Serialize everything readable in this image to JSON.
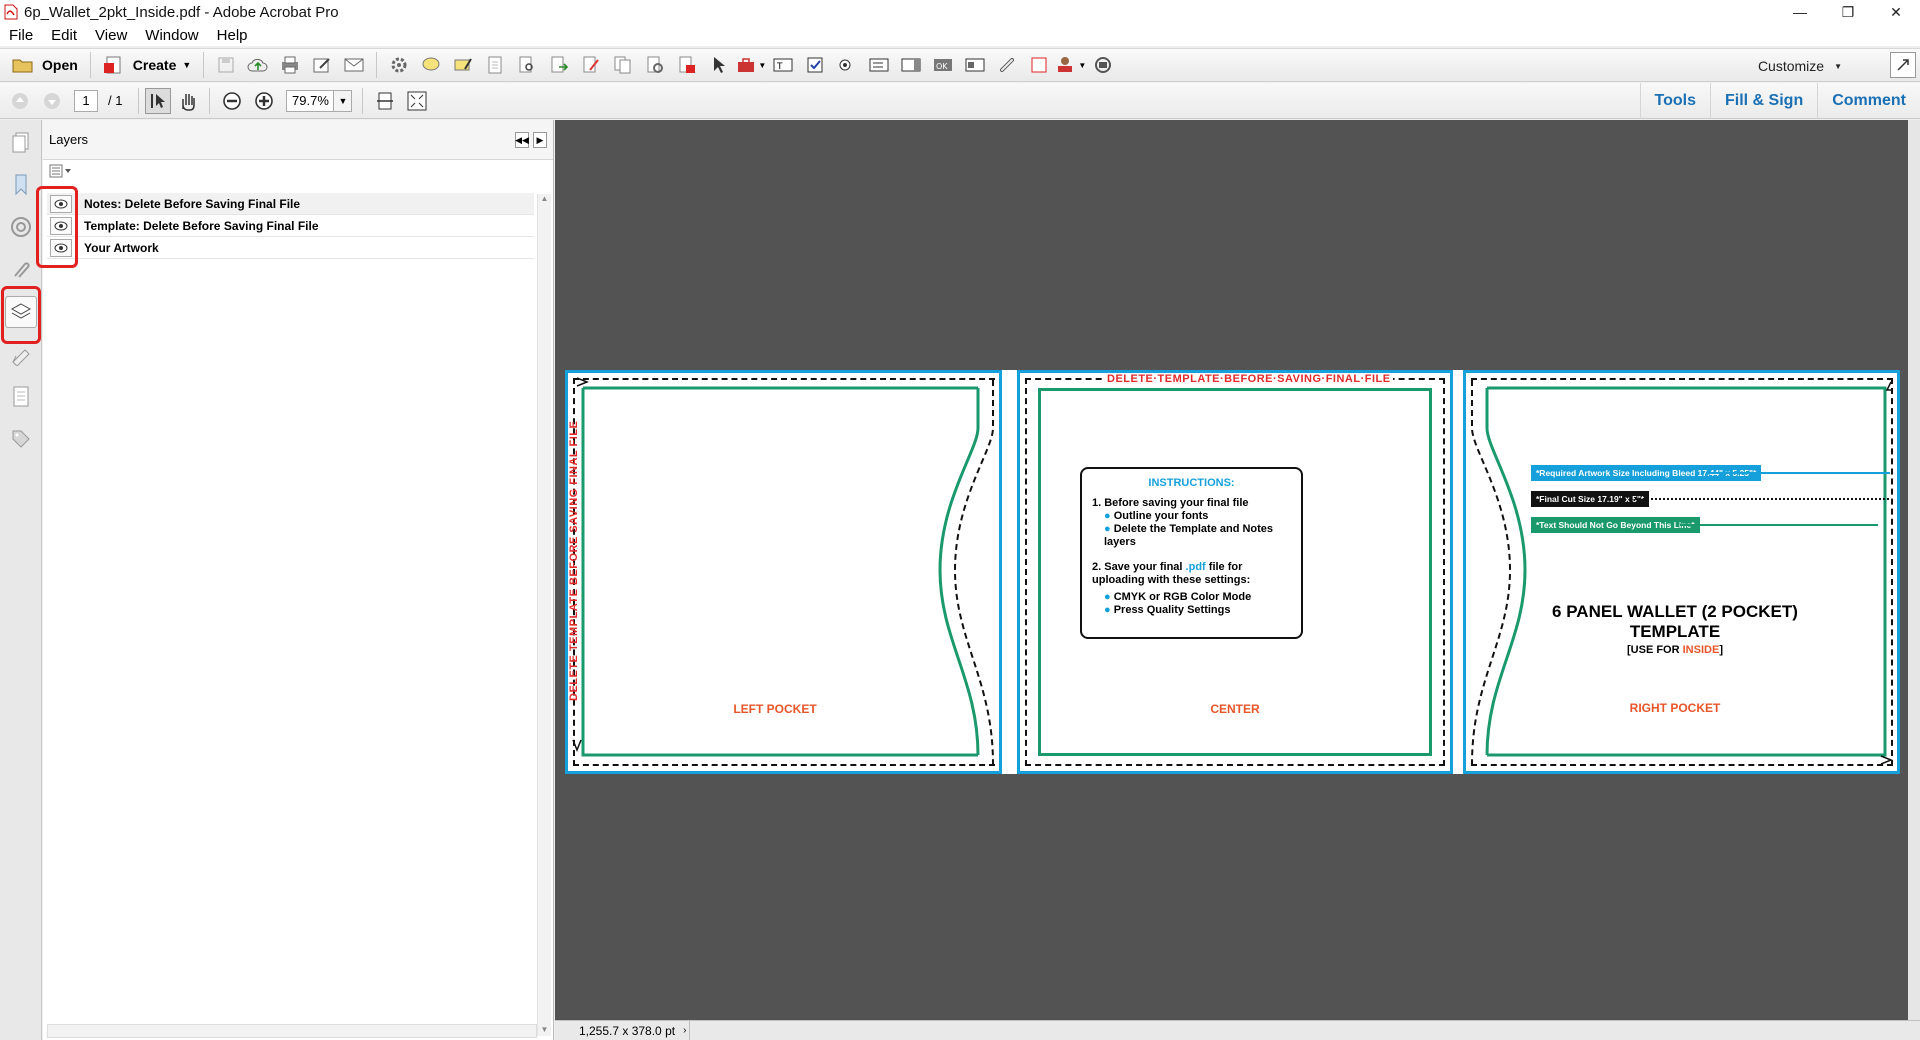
{
  "window": {
    "title": "6p_Wallet_2pkt_Inside.pdf - Adobe Acrobat Pro"
  },
  "menu": [
    "File",
    "Edit",
    "View",
    "Window",
    "Help"
  ],
  "toolbar": {
    "open_label": "Open",
    "create_label": "Create",
    "customize_label": "Customize"
  },
  "nav": {
    "page_current": "1",
    "page_total": "/ 1",
    "zoom": "79.7%"
  },
  "right_tabs": [
    "Tools",
    "Fill & Sign",
    "Comment"
  ],
  "layers_panel": {
    "title": "Layers",
    "layers": [
      {
        "name": "Notes: Delete Before Saving Final File",
        "visible": true
      },
      {
        "name": "Template: Delete Before Saving Final File",
        "visible": true
      },
      {
        "name": "Your Artwork",
        "visible": true
      }
    ]
  },
  "document": {
    "side_note": "DELETE TEMPLATE BEFORE SAVING FINAL FILE",
    "top_note": "DELETE·TEMPLATE·BEFORE·SAVING·FINAL·FILE",
    "left_label": "LEFT POCKET",
    "center_label": "CENTER",
    "right_label": "RIGHT POCKET",
    "instructions": {
      "heading": "INSTRUCTIONS:",
      "step1": "1. Before saving your final file",
      "step1_a": "Outline your fonts",
      "step1_b": "Delete the Template and Notes layers",
      "step2_pre": "2. Save your final ",
      "step2_ext": ".pdf",
      "step2_post": " file for uploading with these settings:",
      "step2_a": "CMYK or RGB Color Mode",
      "step2_b": "Press Quality Settings"
    },
    "bleed_note": "*Required Artwork Size Including Bleed  17.44\" x 5.25\"*",
    "cut_note": "*Final Cut Size  17.19\" x 5\"*",
    "safe_note": "*Text Should Not Go Beyond This Line*",
    "title_line1": "6 PANEL WALLET (2 POCKET)",
    "title_line2": "TEMPLATE",
    "use_for_pre": "[USE FOR ",
    "use_for_word": "INSIDE",
    "use_for_post": "]"
  },
  "status": {
    "page_size": "1,255.7 x 378.0 pt"
  },
  "colors": {
    "bleed": "#16a0db",
    "safe": "#1a9a6c",
    "accent": "#e8552a",
    "highlight": "#e12020"
  }
}
